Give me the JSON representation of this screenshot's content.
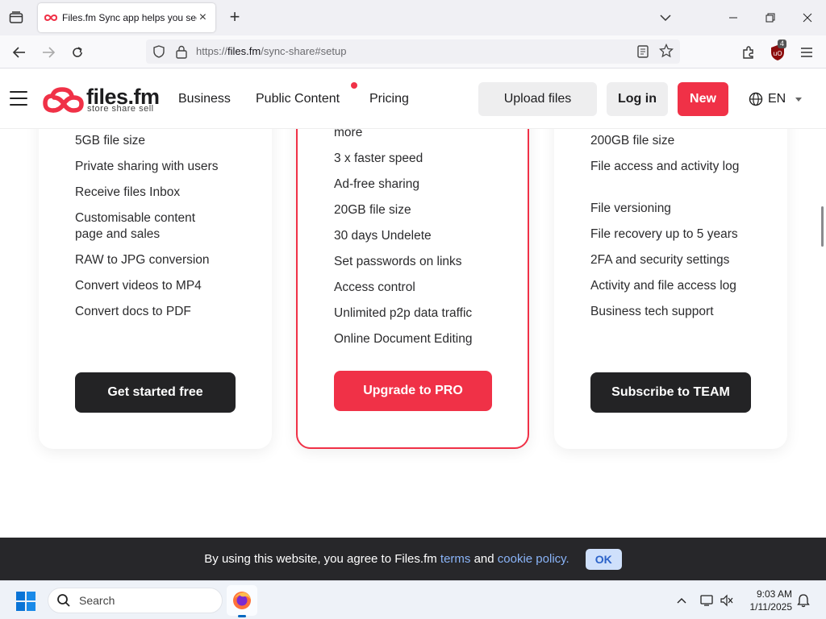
{
  "browser": {
    "tab_title": "Files.fm Sync app helps you securely sync",
    "url_prefix": "https://",
    "url_domain": "files.fm",
    "url_path": "/sync-share#setup",
    "extension_badge": "4"
  },
  "site": {
    "logo_name": "files.fm",
    "logo_tagline": "store share sell",
    "menu": [
      "Business",
      "Public Content",
      "Pricing"
    ],
    "upload_label": "Upload files",
    "login_label": "Log in",
    "new_label": "New",
    "language": "EN",
    "brand_color": "#f03147"
  },
  "plans": {
    "free": {
      "features": [
        "5GB file size",
        "Private sharing with users",
        "Receive files Inbox",
        "Customisable content page and sales",
        "RAW to JPG conversion",
        "Convert videos to MP4",
        "Convert docs to PDF"
      ],
      "cta": "Get started free"
    },
    "pro": {
      "features": [
        "more",
        "3 x faster speed",
        "Ad-free sharing",
        "20GB file size",
        "30 days Undelete",
        "Set passwords on links",
        "Access control",
        "Unlimited p2p data traffic",
        "Online Document Editing"
      ],
      "cta": "Upgrade to PRO"
    },
    "team": {
      "features": [
        "200GB file size",
        "File access and activity log",
        "File versioning",
        "File recovery up to 5 years",
        "2FA and security settings",
        "Activity and file access log",
        "Business tech support"
      ],
      "cta": "Subscribe to TEAM"
    }
  },
  "cookie": {
    "text_before": "By using this website, you agree to Files.fm ",
    "terms": "terms",
    "and": " and ",
    "policy": "cookie policy.",
    "ok": "OK"
  },
  "taskbar": {
    "search_label": "Search",
    "time": "9:03 AM",
    "date": "1/11/2025"
  }
}
